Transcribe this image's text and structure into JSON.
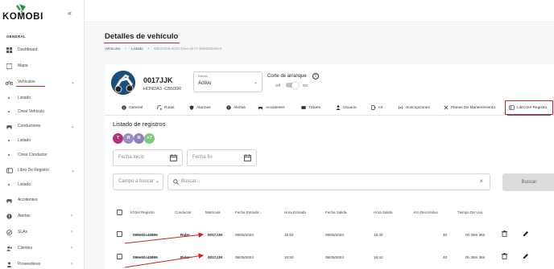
{
  "app": {
    "logo_text": "KOMOBI"
  },
  "sidebar": {
    "section_label": "GENERAL",
    "items": [
      {
        "label": "Dashboard",
        "icon": "dashboard-icon"
      },
      {
        "label": "Mapa",
        "icon": "map-icon"
      },
      {
        "label": "Vehículos",
        "icon": "motorcycle-icon",
        "expanded": true
      },
      {
        "label": "Listado",
        "sub": true
      },
      {
        "label": "Crear Vehículo",
        "sub": true
      },
      {
        "label": "Conductores",
        "icon": "driver-icon",
        "expanded": true
      },
      {
        "label": "Listado",
        "sub": true
      },
      {
        "label": "Crear Conductor",
        "sub": true
      },
      {
        "label": "Libro De Registro",
        "icon": "register-book-icon",
        "expanded": true
      },
      {
        "label": "Listado",
        "sub": true
      },
      {
        "label": "Accidentes",
        "icon": "accident-icon"
      },
      {
        "label": "Alertas",
        "icon": "alert-icon"
      },
      {
        "label": "SLAs",
        "icon": "sla-icon"
      },
      {
        "label": "Clientes",
        "icon": "clients-icon"
      },
      {
        "label": "Proveedores",
        "icon": "providers-icon"
      }
    ]
  },
  "page": {
    "title": "Detalles de vehículo",
    "breadcrumb": [
      "Vehículos",
      "Listado",
      "93b10340-4015-11ee-a277-3fa909dc66e4"
    ]
  },
  "vehicle": {
    "plate": "0017JJK",
    "model": "HONDA3 -CB500R",
    "estado_label": "Estado",
    "estado_value": "Activo",
    "corte_label": "Corte de arranque",
    "off_label": "Off",
    "on_label": "On"
  },
  "tabs": [
    {
      "label": "General",
      "icon": "info-icon"
    },
    {
      "label": "Rutas",
      "icon": "route-icon"
    },
    {
      "label": "Alarmas",
      "icon": "shield-icon"
    },
    {
      "label": "Alertas",
      "icon": "alert-icon"
    },
    {
      "label": "Accidentes",
      "icon": "car-crash-icon"
    },
    {
      "label": "Tickets",
      "icon": "ticket-icon"
    },
    {
      "label": "Usuario",
      "icon": "user-icon"
    },
    {
      "label": "Iot",
      "icon": "iot-icon"
    },
    {
      "label": "Suscripciones",
      "icon": "subscriptions-icon"
    },
    {
      "label": "Planes De Mantenimiento",
      "icon": "wrench-icon"
    },
    {
      "label": "Libro De Registro",
      "icon": "register-book-icon",
      "active": true
    }
  ],
  "registros": {
    "title": "Listado de registros",
    "chips": [
      {
        "letter": "T",
        "color": "#b3307a"
      },
      {
        "letter": "R",
        "color": "#9a8ac8"
      },
      {
        "letter": "R",
        "color": "#8f7fbf"
      },
      {
        "letter": "+7",
        "color": "#7fc97f"
      }
    ],
    "fecha_inicio_placeholder": "Fecha inicio",
    "fecha_fin_placeholder": "Fecha fin",
    "campo_placeholder": "Campo a buscar",
    "search_placeholder": "Buscar...",
    "buscar_button": "Buscar"
  },
  "table": {
    "headers": [
      "Id Del Registro",
      "Conductor",
      "Matrícula",
      "Fecha Entrada",
      "Hora Entrada",
      "Fecha Salida",
      "Hora Salida",
      "Km Recorridos",
      "Tiempo De Uso"
    ],
    "rows": [
      [
        "096e92c40899",
        "Rider",
        "0017JJK",
        "08/05/2024",
        "15:52",
        "08/05/2024",
        "16:42",
        "40",
        "0h 36m 36s"
      ],
      [
        "096e92c40899",
        "Rider",
        "0017JJK",
        "08/05/2024",
        "15:50",
        "08/05/2024",
        "16:42",
        "40",
        "0h 36m 36s"
      ]
    ]
  },
  "colors": {
    "accent_blue": "#1d6bb5",
    "annotation_red": "#d62020",
    "logo_green": "#2f8f4e"
  }
}
